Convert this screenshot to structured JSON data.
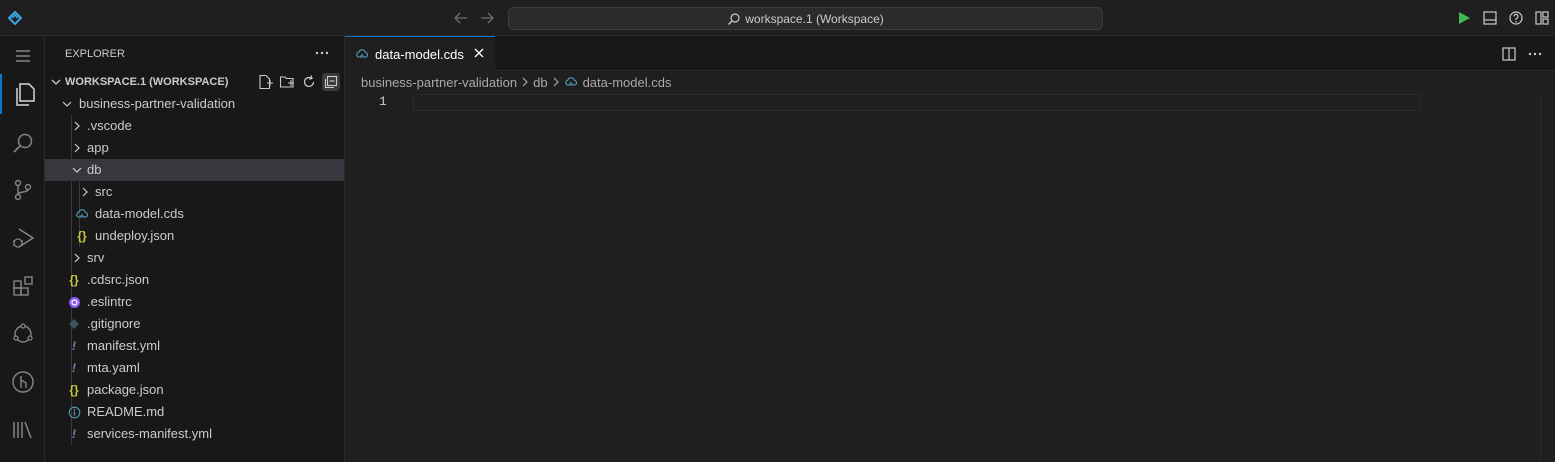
{
  "titlebar": {
    "search_text": "workspace.1 (Workspace)",
    "icons": [
      "app-logo-icon",
      "arrow-left-icon",
      "arrow-right-icon",
      "search-icon",
      "run-icon",
      "toggle-panel-icon",
      "help-icon",
      "customize-layout-icon"
    ]
  },
  "activitybar": {
    "items": [
      "menu-icon",
      "explorer-icon",
      "search-icon",
      "source-control-icon",
      "run-debug-icon",
      "extensions-icon",
      "cloud-services-icon",
      "git-graph-icon",
      "library-icon"
    ],
    "active": "explorer-icon"
  },
  "sidebar": {
    "title": "EXPLORER",
    "workspace_title": "WORKSPACE.1 (WORKSPACE)",
    "workspace_actions": [
      "new-file-icon",
      "new-folder-icon",
      "refresh-icon",
      "collapse-all-icon"
    ],
    "tree": [
      {
        "label": "business-partner-validation",
        "type": "folder",
        "expanded": true
      },
      {
        "label": ".vscode",
        "type": "folder",
        "expanded": false
      },
      {
        "label": "app",
        "type": "folder",
        "expanded": false
      },
      {
        "label": "db",
        "type": "folder",
        "expanded": true,
        "selected": true
      },
      {
        "label": "src",
        "type": "folder",
        "expanded": false
      },
      {
        "label": "data-model.cds",
        "type": "file",
        "icon": "cds-file-icon"
      },
      {
        "label": "undeploy.json",
        "type": "file",
        "icon": "json-file-icon"
      },
      {
        "label": "srv",
        "type": "folder",
        "expanded": false
      },
      {
        "label": ".cdsrc.json",
        "type": "file",
        "icon": "json-file-icon"
      },
      {
        "label": ".eslintrc",
        "type": "file",
        "icon": "eslint-file-icon"
      },
      {
        "label": ".gitignore",
        "type": "file",
        "icon": "git-file-icon"
      },
      {
        "label": "manifest.yml",
        "type": "file",
        "icon": "yaml-file-icon"
      },
      {
        "label": "mta.yaml",
        "type": "file",
        "icon": "yaml-file-icon"
      },
      {
        "label": "package.json",
        "type": "file",
        "icon": "json-file-icon"
      },
      {
        "label": "README.md",
        "type": "file",
        "icon": "info-file-icon"
      },
      {
        "label": "services-manifest.yml",
        "type": "file",
        "icon": "yaml-file-icon"
      }
    ]
  },
  "editor": {
    "tab": {
      "label": "data-model.cds"
    },
    "breadcrumb": [
      "business-partner-validation",
      "db",
      "data-model.cds"
    ],
    "line_numbers": [
      "1"
    ]
  },
  "colors": {
    "accent": "#0078d4",
    "run_green": "#3fb950",
    "json_yellow": "#cbcb41",
    "yaml_purple": "#a074c4",
    "eslint_purple": "#8b5cf6",
    "cds_blue": "#519aba"
  }
}
